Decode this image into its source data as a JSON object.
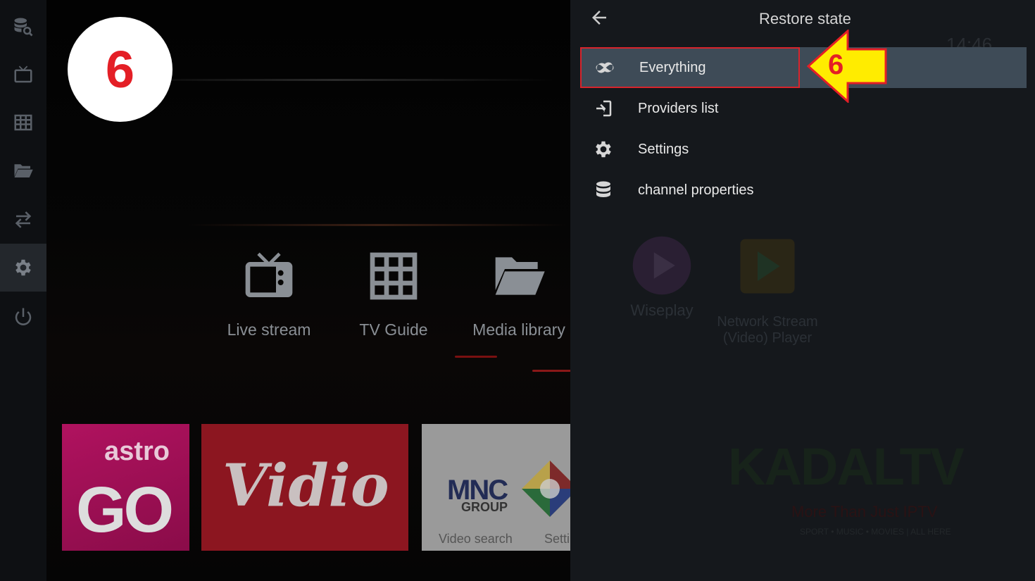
{
  "step_badge": "6",
  "rail": {
    "items": [
      {
        "icon": "search-database-icon"
      },
      {
        "icon": "tv-icon"
      },
      {
        "icon": "grid-icon"
      },
      {
        "icon": "folder-icon"
      },
      {
        "icon": "swap-icon"
      },
      {
        "icon": "gear-icon"
      },
      {
        "icon": "power-icon"
      }
    ]
  },
  "home": {
    "apps": [
      {
        "label": "Live stream",
        "icon": "tv-icon"
      },
      {
        "label": "TV Guide",
        "icon": "grid-icon"
      },
      {
        "label": "Media library",
        "icon": "folder-icon"
      },
      {
        "label": "Wiseplay",
        "icon": "play-circle-icon"
      },
      {
        "label": "Network Stream (Video) Player",
        "icon": "play-store-icon"
      }
    ],
    "tiles": {
      "astro_top": "astro",
      "astro_main": "GO",
      "vidio": "Vidio",
      "mnc": "MNC",
      "mnc_group": "GROUP",
      "video_search": "Video search",
      "settings": "Settings"
    }
  },
  "panel": {
    "title": "Restore state",
    "clock": "14:46",
    "menu": [
      {
        "label": "Everything",
        "icon": "infinity-icon",
        "selected": true
      },
      {
        "label": "Providers list",
        "icon": "login-icon",
        "selected": false
      },
      {
        "label": "Settings",
        "icon": "gear-icon",
        "selected": false
      },
      {
        "label": "channel properties",
        "icon": "database-icon",
        "selected": false
      }
    ],
    "callout_number": "6"
  },
  "watermark": {
    "title": "KADALTV",
    "tagline": "More Than Just IPTV",
    "categories": "SPORT • MUSIC • MOVIES | ALL HERE"
  },
  "colors": {
    "badge_text": "#e41f26",
    "selection_border": "#d8242c",
    "selection_bg": "#3e4b57",
    "arrow_fill": "#ffec00"
  }
}
